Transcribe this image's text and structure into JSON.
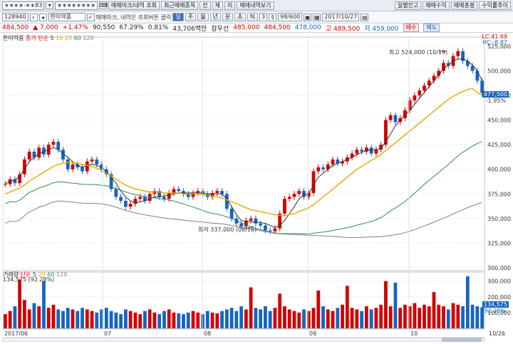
{
  "toolbar1": {
    "masked_id": "∗∗∗∗-∗∗83",
    "masked_pw": "∗∗∗∗∗∗∗∗",
    "buttons": [
      "매매마크/내역 조회",
      "최근매매종목",
      "잔",
      "체",
      "미",
      "매매내역보기"
    ],
    "right_buttons": [
      "일별잔고",
      "매매수익",
      "매매총평",
      "수익률추이"
    ]
  },
  "toolbar2": {
    "code": "128940",
    "stock_name": "한미약품",
    "checkbox_label": "매매마크, 내역은 조회버튼 클릭",
    "period_tabs": [
      "일",
      "주",
      "월",
      "년",
      "분",
      "초",
      "틱"
    ],
    "period_value": "3",
    "page_count": "98/600",
    "date": "2017/10/27"
  },
  "quote": {
    "price": "484,500",
    "change": "▲ 7,000",
    "change_pct": "+1.47%",
    "volume": "90,550",
    "turnover_pct": "67.29%",
    "ratio": "0.81%",
    "amount": "43,706백만",
    "preferred": "참우선",
    "open": "485,000",
    "high": "484,500",
    "low": "478,000",
    "prev": "고 489,500",
    "base": "저 459,000",
    "buy_label": "매수",
    "sell_label": "매도"
  },
  "price_panel": {
    "legend_name": "한미약품",
    "legend_ma": "종가 단순",
    "ma_periods": [
      "5",
      "10",
      "20",
      "60",
      "120"
    ],
    "corner_lc": "LC:41.69",
    "corner_hc": "HC:-8.87",
    "high_annotation": "최고 524,000 (10/19)",
    "low_annotation": "최저 337,000 (08/16)",
    "current_price_tag": "477,500",
    "current_pct": "-1.95%"
  },
  "volume_panel": {
    "legend_name": "거래량",
    "legend_ma": "단순",
    "ma_periods": [
      "5",
      "20",
      "60",
      "120"
    ],
    "readout": "134,575 (92.28%)",
    "current_tag": "134,575",
    "current_pct": "92.28%"
  },
  "date_labels": [
    "2017/06",
    "07",
    "08",
    "09",
    "10",
    "10/26"
  ],
  "colors": {
    "up": "#d20000",
    "down": "#1565c0",
    "ma5": "#333333",
    "ma10": "#e6a800",
    "ma20": "#2e8b57",
    "ma60": "#808080"
  },
  "chart_data": {
    "type": "candlestick",
    "x_range": [
      "2017-06",
      "2017-10-26"
    ],
    "y_price_ticks": [
      300000,
      325000,
      350000,
      375000,
      400000,
      425000,
      450000,
      475000,
      500000,
      525000
    ],
    "y_volume_ticks": [
      100000,
      200000,
      300000
    ],
    "ylim_price": [
      300000,
      530000
    ],
    "ylim_volume": [
      0,
      330000
    ],
    "closes": [
      385000,
      390000,
      386000,
      395000,
      410000,
      418000,
      412000,
      422000,
      415000,
      425000,
      428000,
      420000,
      410000,
      400000,
      405000,
      402000,
      398000,
      408000,
      410000,
      405000,
      400000,
      395000,
      380000,
      372000,
      368000,
      362000,
      365000,
      370000,
      372000,
      368000,
      375000,
      378000,
      372000,
      370000,
      376000,
      380000,
      378000,
      375000,
      372000,
      376000,
      378000,
      375000,
      372000,
      376000,
      378000,
      375000,
      360000,
      350000,
      345000,
      342000,
      348000,
      350000,
      345000,
      343000,
      338000,
      337000,
      340000,
      355000,
      370000,
      372000,
      375000,
      378000,
      372000,
      376000,
      398000,
      402000,
      400000,
      405000,
      410000,
      406000,
      408000,
      412000,
      416000,
      420000,
      418000,
      422000,
      416000,
      420000,
      425000,
      450000,
      455000,
      448000,
      452000,
      460000,
      470000,
      475000,
      480000,
      485000,
      490000,
      495000,
      500000,
      508000,
      505000,
      515000,
      520000,
      510000,
      505000,
      500000,
      490000,
      477500
    ],
    "volumes": [
      90000,
      110000,
      140000,
      310000,
      180000,
      120000,
      160000,
      140000,
      300000,
      130000,
      150000,
      120000,
      110000,
      130000,
      120000,
      110000,
      130000,
      120000,
      110000,
      100000,
      120000,
      130000,
      110000,
      100000,
      90000,
      120000,
      110000,
      100000,
      90000,
      110000,
      120000,
      100000,
      90000,
      110000,
      120000,
      100000,
      95000,
      90000,
      100000,
      110000,
      100000,
      90000,
      110000,
      100000,
      95000,
      110000,
      120000,
      130000,
      110000,
      140000,
      120000,
      260000,
      130000,
      120000,
      140000,
      110000,
      130000,
      220000,
      140000,
      120000,
      110000,
      100000,
      120000,
      110000,
      130000,
      240000,
      140000,
      120000,
      110000,
      130000,
      150000,
      270000,
      130000,
      120000,
      110000,
      140000,
      120000,
      130000,
      150000,
      300000,
      140000,
      290000,
      130000,
      150000,
      140000,
      160000,
      130000,
      150000,
      140000,
      230000,
      150000,
      140000,
      120000,
      160000,
      150000,
      140000,
      330000,
      150000,
      140000,
      134575
    ],
    "series": [
      {
        "name": "5",
        "values": [
          385000,
          388000,
          389000,
          393000,
          400000,
          408000,
          412000,
          416000,
          418000,
          420000,
          422000,
          420000,
          416000,
          412000,
          408000,
          404000,
          402000,
          404000,
          405000,
          404000,
          402000,
          398000,
          392000,
          386000,
          378000,
          372000,
          368000,
          366000,
          367000,
          368000,
          370000,
          372000,
          372000,
          373000,
          374000,
          375000,
          376000,
          376000,
          376000,
          376000,
          376000,
          376000,
          375000,
          375000,
          375000,
          375000,
          370000,
          362000,
          354000,
          348000,
          347000,
          347000,
          346000,
          346000,
          345000,
          343000,
          341000,
          343000,
          348000,
          355000,
          362000,
          370000,
          374000,
          375000,
          384000,
          392000,
          396000,
          400000,
          404000,
          406000,
          408000,
          410000,
          412000,
          415000,
          417000,
          419000,
          420000,
          420000,
          421000,
          428000,
          436000,
          444000,
          450000,
          455000,
          460000,
          466000,
          472000,
          478000,
          484000,
          490000,
          496000,
          502000,
          506000,
          510000,
          512000,
          512000,
          510000,
          506000,
          500000,
          490000
        ]
      },
      {
        "name": "20",
        "values": [
          375000,
          377000,
          379000,
          381000,
          384000,
          388000,
          391000,
          394000,
          397000,
          400000,
          403000,
          405000,
          406000,
          407000,
          407000,
          406000,
          405000,
          404000,
          403000,
          401000,
          399000,
          396000,
          393000,
          390000,
          387000,
          384000,
          382000,
          380000,
          379000,
          378000,
          377000,
          377000,
          377000,
          376000,
          376000,
          376000,
          376000,
          375000,
          375000,
          375000,
          375000,
          374000,
          374000,
          373000,
          372000,
          371000,
          369000,
          367000,
          365000,
          363000,
          361000,
          359000,
          358000,
          357000,
          356000,
          355000,
          354000,
          353000,
          353000,
          354000,
          355000,
          357000,
          359000,
          361000,
          364000,
          368000,
          372000,
          376000,
          380000,
          384000,
          388000,
          392000,
          396000,
          400000,
          403000,
          406000,
          409000,
          412000,
          415000,
          419000,
          423000,
          427000,
          431000,
          435000,
          439000,
          443000,
          447000,
          451000,
          455000,
          459000,
          463000,
          467000,
          471000,
          474000,
          477000,
          479000,
          481000,
          482000,
          478000,
          475000
        ]
      }
    ]
  }
}
